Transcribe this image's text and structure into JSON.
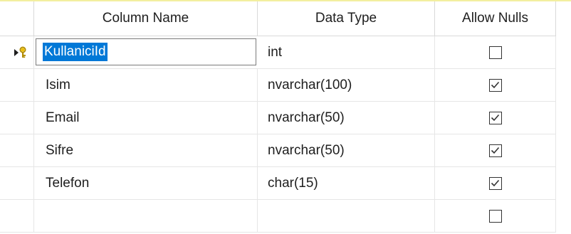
{
  "columns": {
    "name_header": "Column Name",
    "type_header": "Data Type",
    "nulls_header": "Allow Nulls"
  },
  "rows": [
    {
      "name": "KullaniciId",
      "type": "int",
      "allow_nulls": false,
      "primary_key": true,
      "selected": true
    },
    {
      "name": "Isim",
      "type": "nvarchar(100)",
      "allow_nulls": true
    },
    {
      "name": "Email",
      "type": "nvarchar(50)",
      "allow_nulls": true
    },
    {
      "name": "Sifre",
      "type": "nvarchar(50)",
      "allow_nulls": true
    },
    {
      "name": "Telefon",
      "type": "char(15)",
      "allow_nulls": true
    },
    {
      "name": "",
      "type": "",
      "allow_nulls": false
    }
  ],
  "icons": {
    "row_selector": "current-row-arrow-key-icon",
    "primary_key": "key-icon"
  },
  "colors": {
    "selection": "#0078d7",
    "accent": "#f3ef9f",
    "key": "#f0c000"
  }
}
